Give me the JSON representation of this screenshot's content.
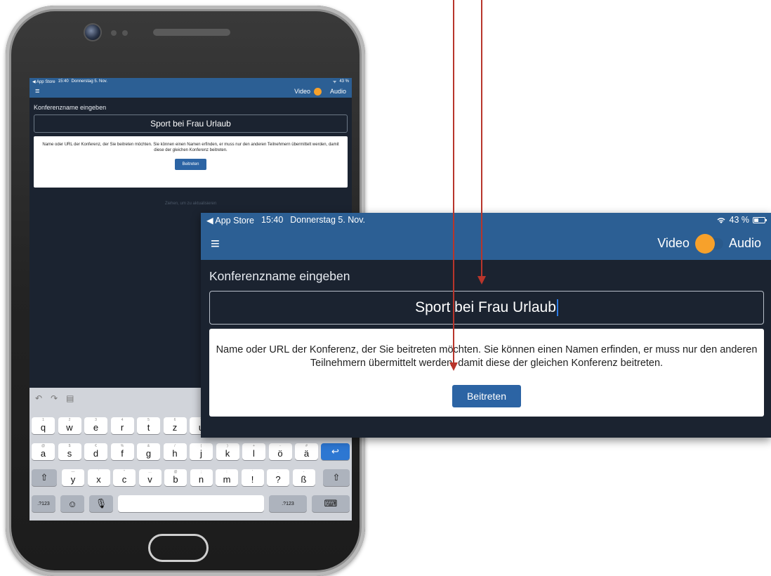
{
  "status_bar": {
    "back_label": "◀ App Store",
    "time": "15:40",
    "date": "Donnerstag 5. Nov.",
    "battery": "43 %"
  },
  "nav": {
    "menu_icon": "hamburger-icon",
    "video_label": "Video",
    "audio_label": "Audio"
  },
  "form": {
    "label": "Konferenzname eingeben",
    "input_value": "Sport bei Frau Urlaub",
    "info_text": "Name oder URL der Konferenz, der Sie beitreten möchten. Sie können einen Namen erfinden, er muss nur den anderen Teilnehmern übermittelt werden, damit diese der gleichen Konferenz beitreten.",
    "join_button": "Beitreten"
  },
  "pull_hint": "Ziehen, um zu aktualisieren",
  "keyboard": {
    "row1": [
      {
        "k": "q",
        "s": "1"
      },
      {
        "k": "w",
        "s": "2"
      },
      {
        "k": "e",
        "s": "3"
      },
      {
        "k": "r",
        "s": "4"
      },
      {
        "k": "t",
        "s": "5"
      },
      {
        "k": "z",
        "s": "6"
      },
      {
        "k": "u",
        "s": "7"
      }
    ],
    "row2": [
      {
        "k": "a",
        "s": "@"
      },
      {
        "k": "s",
        "s": "$"
      },
      {
        "k": "d",
        "s": "€"
      },
      {
        "k": "f",
        "s": "%"
      },
      {
        "k": "g",
        "s": "&"
      },
      {
        "k": "h",
        "s": "/"
      },
      {
        "k": "j",
        "s": "("
      },
      {
        "k": "k",
        "s": ")"
      },
      {
        "k": "l",
        "s": "+"
      },
      {
        "k": "ö",
        "s": "-"
      },
      {
        "k": "ä",
        "s": "#"
      }
    ],
    "row3": [
      {
        "k": "y",
        "s": "—"
      },
      {
        "k": "x",
        "s": "`"
      },
      {
        "k": "c",
        "s": "\""
      },
      {
        "k": "v",
        "s": "…"
      },
      {
        "k": "b",
        "s": "@"
      },
      {
        "k": "n",
        "s": ";"
      },
      {
        "k": "m",
        "s": ":"
      },
      {
        "k": "!",
        "s": "'"
      },
      {
        "k": "?",
        "s": "."
      },
      {
        "k": "ß",
        "s": "-"
      }
    ],
    "numbers_label": ".?123"
  },
  "colors": {
    "header_blue": "#2c5f94",
    "app_background": "#1b2330",
    "toggle_orange": "#f7a12b",
    "button_blue": "#2c64a4",
    "arrow_red": "#b8352b"
  }
}
